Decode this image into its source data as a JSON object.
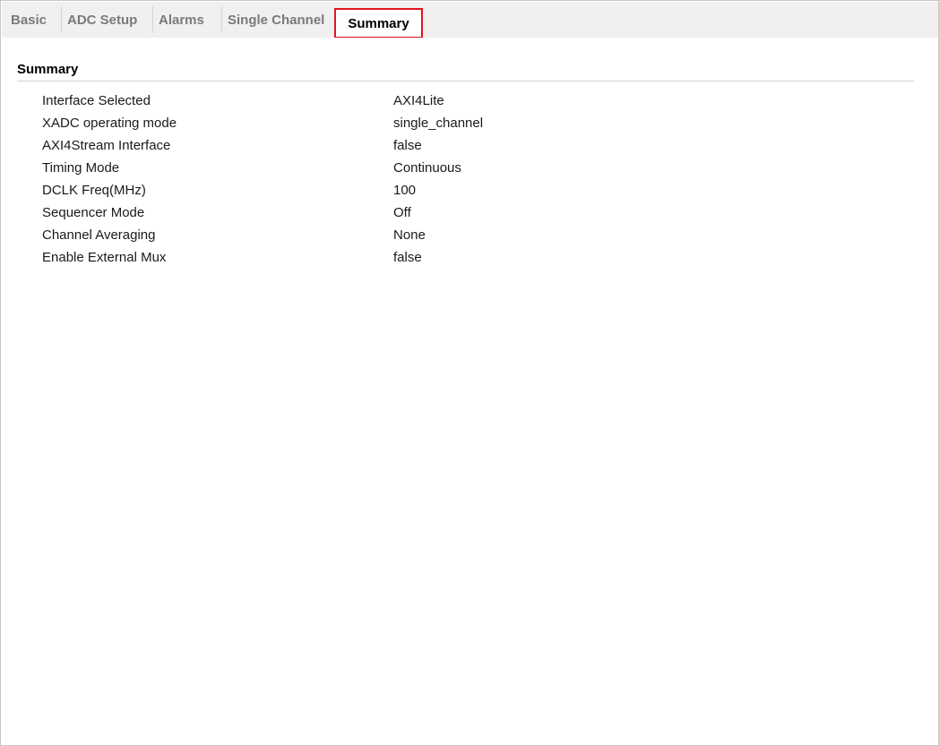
{
  "tabs": [
    {
      "label": "Basic",
      "active": false
    },
    {
      "label": "ADC Setup",
      "active": false
    },
    {
      "label": "Alarms",
      "active": false
    },
    {
      "label": "Single Channel",
      "active": false
    },
    {
      "label": "Summary",
      "active": true
    }
  ],
  "summary": {
    "title": "Summary",
    "rows": [
      {
        "key": "Interface Selected",
        "value": "AXI4Lite"
      },
      {
        "key": "XADC operating mode",
        "value": "single_channel"
      },
      {
        "key": "AXI4Stream Interface",
        "value": "false"
      },
      {
        "key": "Timing Mode",
        "value": "Continuous"
      },
      {
        "key": "DCLK Freq(MHz)",
        "value": "100"
      },
      {
        "key": "Sequencer Mode",
        "value": "Off"
      },
      {
        "key": "Channel Averaging",
        "value": "None"
      },
      {
        "key": "Enable External Mux",
        "value": "false"
      }
    ]
  },
  "colors": {
    "active_tab_border": "#e0141e",
    "tabbar_bg": "#f0f0f0"
  }
}
